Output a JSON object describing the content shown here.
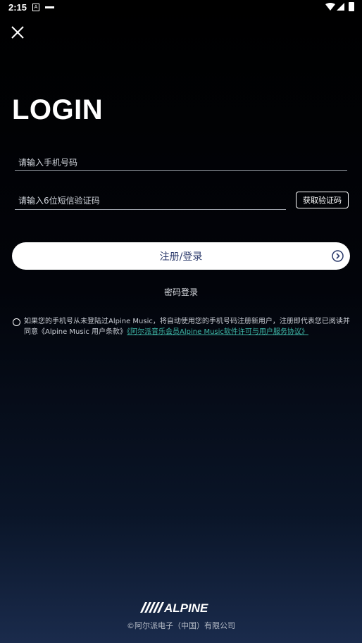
{
  "status_bar": {
    "time": "2:15",
    "notification_letter": "A",
    "icons": [
      "a-notification-icon",
      "dash-icon",
      "wifi-icon",
      "signal-icon",
      "battery-icon"
    ]
  },
  "header": {
    "close_icon": "close-icon",
    "title": "LOGIN"
  },
  "form": {
    "phone_placeholder": "请输入手机号码",
    "code_placeholder": "请输入6位短信验证码",
    "get_code_label": "获取验证码",
    "submit_label": "注册/登录",
    "submit_icon": "chevron-right-circle-icon",
    "password_login_label": "密码登录"
  },
  "agreement": {
    "text": "如果您的手机号从未登陆过Alpine Music，将自动使用您的手机号码注册新用户，注册即代表您已阅读并同意《Alpine Music 用户条款》",
    "link_text": "《阿尔派音乐会员Alpine Music软件许可与用户服务协议》"
  },
  "footer": {
    "copyright": "©阿尔派电子（中国）有限公司",
    "logo_text": "ALPINE"
  },
  "colors": {
    "button_text": "#2b3a6b",
    "link": "#3fb8a8",
    "background_top": "#000000",
    "background_bottom": "#1a2b4c"
  }
}
